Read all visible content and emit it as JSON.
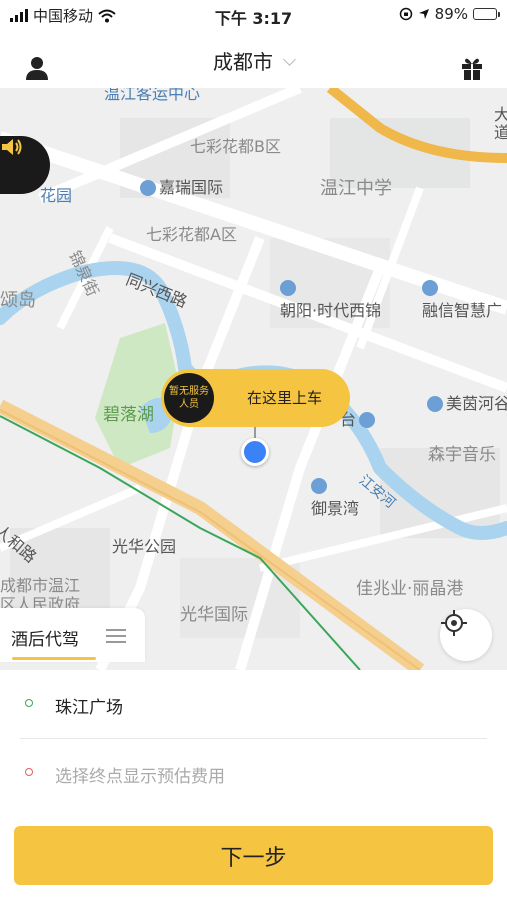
{
  "status_bar": {
    "carrier": "中国移动",
    "time": "下午 3:17",
    "battery": "89%",
    "battery_level": 0.89
  },
  "header": {
    "city": "成都市",
    "left_icon": "user-icon",
    "right_icon": "gift-icon"
  },
  "map": {
    "labels": {
      "wenjiang_bus": "温江客运中心",
      "qicai_b": "七彩花都B区",
      "jiarui": "嘉瑞国际",
      "wenjiang_school": "温江中学",
      "garden": "花园",
      "qicai_a": "七彩花都A区",
      "jinquan_jie": "锦泉街",
      "tongxing_xilu": "同兴西路",
      "song_island": "颂岛",
      "chaoyang": "朝阳·时代西锦",
      "rongxin": "融信智慧广",
      "biluo_lake": "碧落湖",
      "meiyin": "美茵河谷",
      "senyu": "森宇音乐",
      "jiangan_river": "江安河",
      "yujing_wan": "御景湾",
      "renhe_lu": "人和路",
      "guanghua_park": "光华公园",
      "gov": "成都市温江",
      "gov2": "区人民政府",
      "jiazhaoye": "佳兆业·丽晶港",
      "guanghua_intl": "光华国际",
      "tai": "台",
      "edge_right": "大道"
    },
    "pickup_marker": {
      "badge_line1": "暂无服务",
      "badge_line2": "人员",
      "text": "在这里上车"
    },
    "sound_icon": "speaker-icon",
    "locate_icon": "locate-crosshair-icon"
  },
  "service_tab": {
    "label": "酒后代驾",
    "menu_icon": "menu-icon"
  },
  "addresses": {
    "start": {
      "text": "珠江广场",
      "dot_color": "#3aa65a"
    },
    "end": {
      "placeholder": "选择终点显示预估费用",
      "dot_color": "#e06060"
    }
  },
  "next_button": "下一步",
  "colors": {
    "accent": "#f5c542",
    "dark": "#1a1a1a",
    "location_blue": "#3b82f6"
  }
}
